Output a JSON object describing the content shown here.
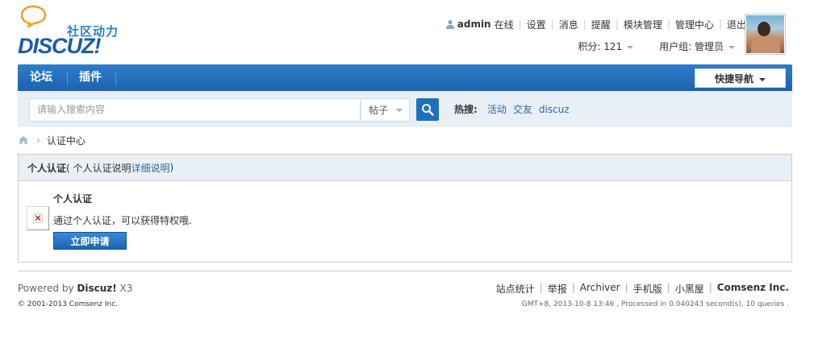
{
  "logo": {
    "cn": "社区动力",
    "en": "DISCUZ!"
  },
  "user": {
    "name": "admin",
    "status": "在线",
    "links": [
      "设置",
      "消息",
      "提醒",
      "模块管理",
      "管理中心",
      "退出"
    ],
    "points_label": "积分: 121",
    "group_label": "用户组: 管理员"
  },
  "nav": {
    "items": [
      "论坛",
      "插件"
    ],
    "quick_nav": "快捷导航"
  },
  "search": {
    "placeholder": "请输入搜索内容",
    "type": "帖子",
    "hot_label": "热搜:",
    "hot_keywords": [
      "活动",
      "交友",
      "discuz"
    ]
  },
  "breadcrumb": {
    "current": "认证中心"
  },
  "verify": {
    "header_title": "个人认证",
    "header_open": " ( 个人认证说明",
    "header_link": "详细说明",
    "header_close": " )",
    "item_title": "个人认证",
    "item_desc": "通过个人认证，可以获得特权哦.",
    "apply_button": "立即申请"
  },
  "footer": {
    "powered_prefix": "Powered by ",
    "powered_brand": "Discuz!",
    "powered_version": " X3",
    "copyright": "© 2001-2013 Comsenz Inc.",
    "links": [
      "站点统计",
      "举报",
      "Archiver",
      "手机版",
      "小黑屋"
    ],
    "brand": "Comsenz Inc.",
    "stats": "GMT+8, 2013-10-8 13:46 , Processed in 0.040243 second(s), 10 queries ."
  },
  "colors": {
    "nav": "#1c63b1",
    "link": "#336699",
    "search_bar": "#e8eff5"
  }
}
